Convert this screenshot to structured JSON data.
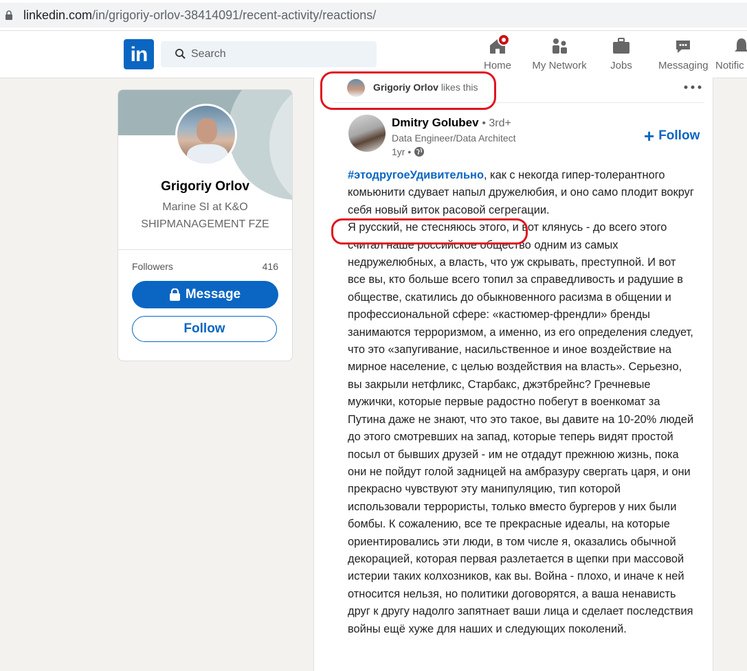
{
  "browser": {
    "url_domain": "linkedin.com",
    "url_path": "/in/grigoriy-orlov-38414091/recent-activity/reactions/"
  },
  "nav": {
    "logo_text": "in",
    "search_placeholder": "Search",
    "items": [
      {
        "label": "Home",
        "icon": "home-icon",
        "badge": true
      },
      {
        "label": "My Network",
        "icon": "network-icon"
      },
      {
        "label": "Jobs",
        "icon": "briefcase-icon"
      },
      {
        "label": "Messaging",
        "icon": "chat-icon"
      },
      {
        "label": "Notific",
        "icon": "bell-icon"
      }
    ]
  },
  "profile": {
    "name": "Grigoriy Orlov",
    "headline": "Marine SI at K&O SHIPMANAGEMENT FZE",
    "followers_label": "Followers",
    "followers_count": "416",
    "message_label": "Message",
    "follow_label": "Follow"
  },
  "post": {
    "reactor_name": "Grigoriy Orlov",
    "reactor_action": "likes this",
    "author_name": "Dmitry Golubev",
    "author_degree": "• 3rd+",
    "author_title": "Data Engineer/Data Architect",
    "time": "1yr •",
    "follow_label": "Follow",
    "hashtag": "#этодругоеУдивительно",
    "body_after_hashtag": ", как с некогда гипер-толерантного комьюнити сдувает напыл дружелюбия, и оно само плодит вокруг себя новый виток расовой сегрегации.",
    "body_paragraph_2": "Я русский, не стесняюсь этого, и вот клянусь - до всего этого считал наше российское общество одним из самых недружелюбных, а власть, что уж скрывать, преступной. И вот все вы, кто больше всего топил за справедливость и радушие в обществе, скатились до обыкновенного расизма в общении и профессиональной сфере: «кастюмер-френдли» бренды занимаются терроризмом, а именно, из его определения следует, что это «запугивание, насильственное и иное воздействие на мирное население, с целью воздействия на власть». Серьезно, вы закрыли нетфликс, Старбакс, джэтбрейнс? Гречневые мужички, которые первые радостно побегут в военкомат за Путина даже не знают, что это такое, вы давите на 10-20% людей до этого смотревших на запад, которые теперь видят простой посыл от бывших друзей - им не отдадут прежнюю жизнь, пока они не пойдут голой задницей на амбразуру свергать царя, и они прекрасно чувствуют эту манипуляцию, тип которой использовали террористы, только вместо бургеров у них были бомбы. К сожалению, все те прекрасные идеалы, на которые ориентировались эти люди, в том числе я, оказались обычной декорацией, которая первая разлетается в щепки при массовой истерии таких колхозников, как вы. Война - плохо, и иначе к ней относится нельзя, но политики договорятся, а ваша ненависть друг к другу надолго запятнает ваши лица и сделает последствия войны ещё хуже для наших и следующих поколений."
  },
  "colors": {
    "linkedin_blue": "#0a66c2",
    "annotation_red": "#e0141e",
    "page_bg": "#f3f2ef"
  }
}
